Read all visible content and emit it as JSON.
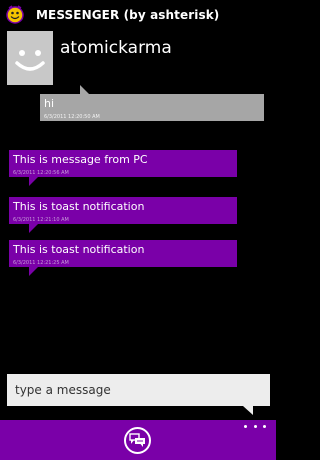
{
  "header": {
    "title": "MESSENGER (by ashterisk)",
    "icon": "messenger-smiley-icon"
  },
  "contact": {
    "name": "atomickarma",
    "avatar_icon": "smiley-avatar-icon"
  },
  "messages": [
    {
      "direction": "outgoing",
      "text": "hi",
      "time": "6/3/2011 12:20:50 AM"
    },
    {
      "direction": "incoming",
      "text": "This is message from PC",
      "time": "6/3/2011 12:20:56 AM"
    },
    {
      "direction": "incoming",
      "text": "This is toast notification",
      "time": "6/3/2011 12:21:10 AM"
    },
    {
      "direction": "incoming",
      "text": "This is toast notification",
      "time": "6/3/2011 12:21:25 AM"
    }
  ],
  "composer": {
    "placeholder": "type a message"
  },
  "app_bar": {
    "send_icon": "send-message-icon",
    "more_icon": "more-ellipsis-icon"
  },
  "colors": {
    "accent": "#7a00a8",
    "outgoing_bubble": "#a6a6a6",
    "avatar_bg": "#c8c8c8",
    "background": "#000000"
  }
}
